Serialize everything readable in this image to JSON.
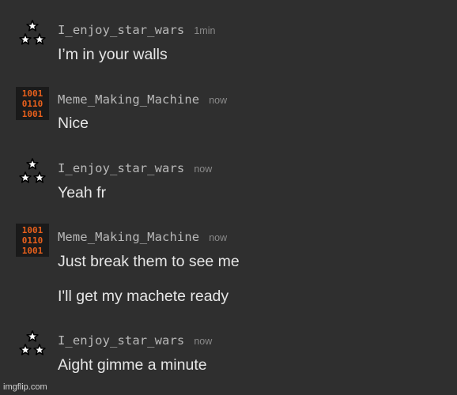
{
  "messages": [
    {
      "username": "I_enjoy_star_wars",
      "time": "1min",
      "avatar_icon": "stars-avatar-icon",
      "lines": [
        "I’m in your walls"
      ]
    },
    {
      "username": "Meme_Making_Machine",
      "time": "now",
      "avatar_icon": "binary-avatar-icon",
      "lines": [
        "Nice"
      ]
    },
    {
      "username": "I_enjoy_star_wars",
      "time": "now",
      "avatar_icon": "stars-avatar-icon",
      "lines": [
        "Yeah fr"
      ]
    },
    {
      "username": "Meme_Making_Machine",
      "time": "now",
      "avatar_icon": "binary-avatar-icon",
      "lines": [
        "Just break them to see me",
        "I'll get my machete ready"
      ]
    },
    {
      "username": "I_enjoy_star_wars",
      "time": "now",
      "avatar_icon": "stars-avatar-icon",
      "lines": [
        "Aight gimme a minute"
      ]
    }
  ],
  "watermark": "imgflip.com",
  "colors": {
    "background": "#2f2f2f",
    "username": "#b9b9b9",
    "timestamp": "#8a8a8a",
    "message_text": "#e6e6e6",
    "binary_avatar_accent": "#e8601c"
  }
}
